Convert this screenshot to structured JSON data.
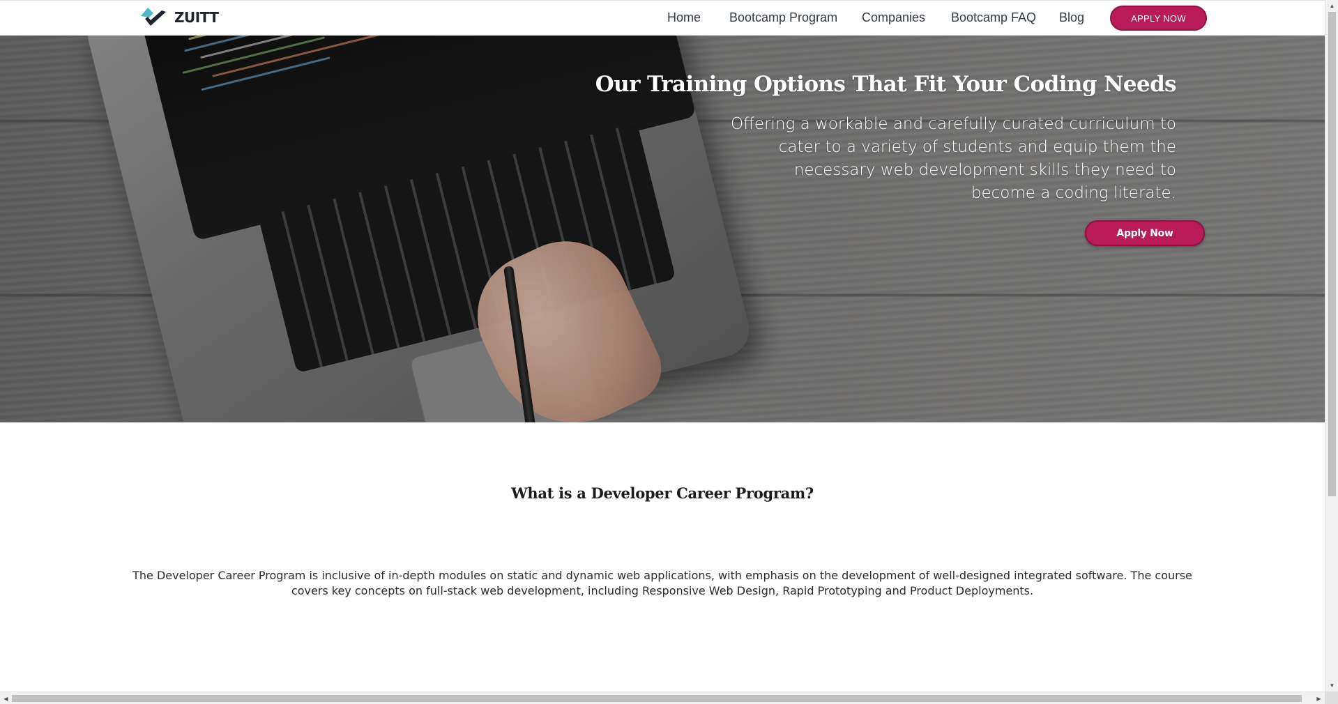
{
  "brand": {
    "name": "ZUITT",
    "logo_icon": "zuitt-logo-icon"
  },
  "nav": {
    "items": [
      {
        "label": "Home"
      },
      {
        "label": "Bootcamp Program"
      },
      {
        "label": "Companies"
      },
      {
        "label": "Bootcamp FAQ"
      },
      {
        "label": "Blog"
      }
    ],
    "apply_label": "APPLY NOW"
  },
  "hero": {
    "title": "Our Training Options That Fit Your Coding Needs",
    "text": "Offering a workable and carefully curated curriculum to cater to a variety of students and equip them the necessary web development skills they need to become a coding literate.",
    "apply_label": "Apply Now"
  },
  "section": {
    "title": "What is a Developer Career Program?",
    "text": "The Developer Career Program is inclusive of in-depth modules on static and dynamic web applications, with emphasis on the development of well-designed integrated software. The course covers key concepts on full-stack web development, including Responsive Web Design, Rapid Prototyping and Product Deployments."
  },
  "colors": {
    "accent": "#b81b57",
    "logo_teal": "#4fb7c5",
    "logo_dark": "#1d2430"
  },
  "scrollbars": {
    "up_icon": "scroll-up-arrow-icon",
    "down_icon": "scroll-down-arrow-icon",
    "left_icon": "scroll-left-arrow-icon",
    "right_icon": "scroll-right-arrow-icon"
  }
}
